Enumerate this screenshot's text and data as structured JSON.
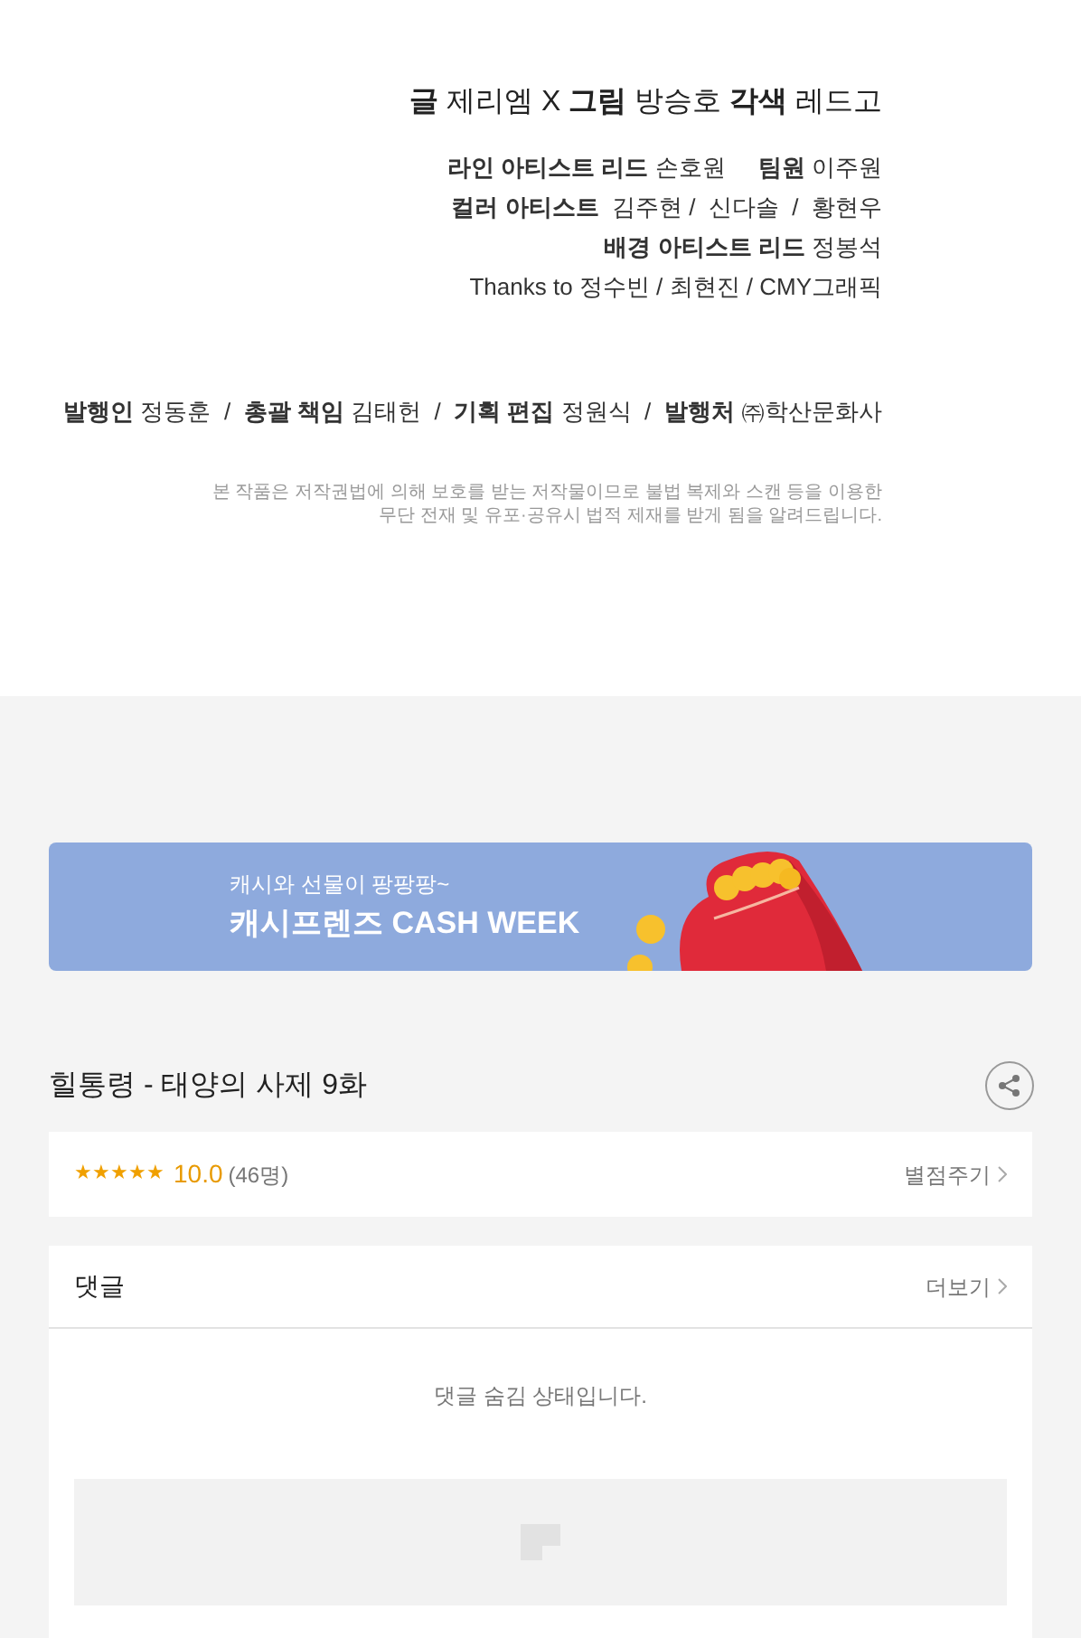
{
  "credits": {
    "main": "**글** 제리엠 X **그림** 방승호 **각색** 레드고",
    "lines": [
      "**라인 아티스트 리드** 손호원     **팀원** 이주원",
      "**컬러 아티스트**  김주현 /  신다솔  /  황현우",
      "**배경 아티스트 리드** 정봉석",
      "Thanks to 정수빈 / 최현진 / CMY그래픽"
    ],
    "publisher": "**발행인** 정동훈  /  **총괄 책임** 김태헌  /  **기획 편집** 정원식  /  **발행처** ㈜학산문화사",
    "notice": [
      "본 작품은 저작권법에 의해 보호를 받는 저작물이므로 불법 복제와 스캔 등을 이용한",
      "무단 전재 및 유포·공유시 법적 제재를 받게 됨을 알려드립니다."
    ]
  },
  "banner": {
    "subtitle": "캐시와 선물이 팡팡팡~",
    "title": "캐시프렌즈 CASH WEEK",
    "kind": "picture"
  },
  "episode": {
    "title": "힐통령 - 태양의 사제 9화"
  },
  "rating": {
    "stars": 5,
    "score": "10.0",
    "count": "(46명)",
    "action": "별점주기"
  },
  "comments": {
    "title": "댓글",
    "more": "더보기",
    "message": "댓글 숨김 상태입니다."
  }
}
